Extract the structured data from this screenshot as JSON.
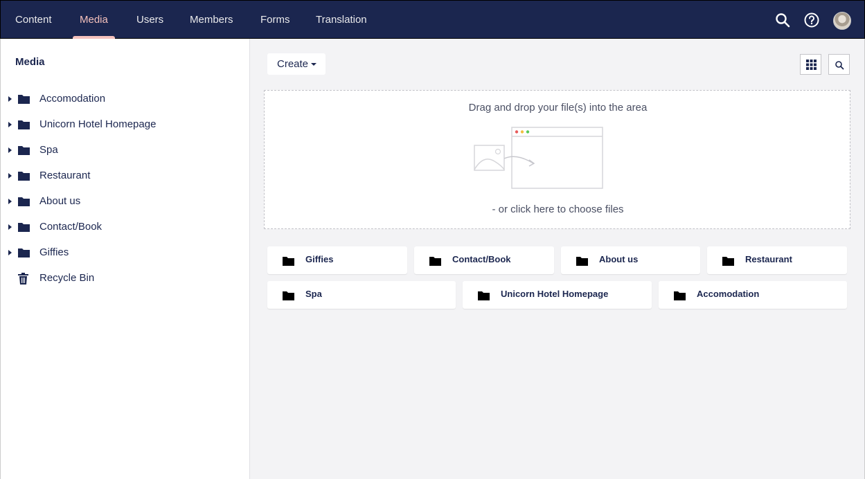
{
  "topnav": {
    "items": [
      {
        "label": "Content"
      },
      {
        "label": "Media"
      },
      {
        "label": "Users"
      },
      {
        "label": "Members"
      },
      {
        "label": "Forms"
      },
      {
        "label": "Translation"
      }
    ],
    "active": "Media"
  },
  "sidebar": {
    "title": "Media",
    "items": [
      {
        "label": "Accomodation"
      },
      {
        "label": "Unicorn Hotel Homepage"
      },
      {
        "label": "Spa"
      },
      {
        "label": "Restaurant"
      },
      {
        "label": "About us"
      },
      {
        "label": "Contact/Book"
      },
      {
        "label": "Giffies"
      },
      {
        "label": "Recycle Bin"
      }
    ]
  },
  "toolbar": {
    "create_label": "Create"
  },
  "dropzone": {
    "title": "Drag and drop your file(s) into the area",
    "subtitle": "- or click here to choose files"
  },
  "folders": [
    {
      "label": "Giffies"
    },
    {
      "label": "Contact/Book"
    },
    {
      "label": "About us"
    },
    {
      "label": "Restaurant"
    },
    {
      "label": "Spa"
    },
    {
      "label": "Unicorn Hotel Homepage"
    },
    {
      "label": "Accomodation"
    }
  ],
  "colors": {
    "nav_bg": "#1b264f",
    "accent": "#f5c1bc",
    "main_bg": "#f3f3f5"
  }
}
